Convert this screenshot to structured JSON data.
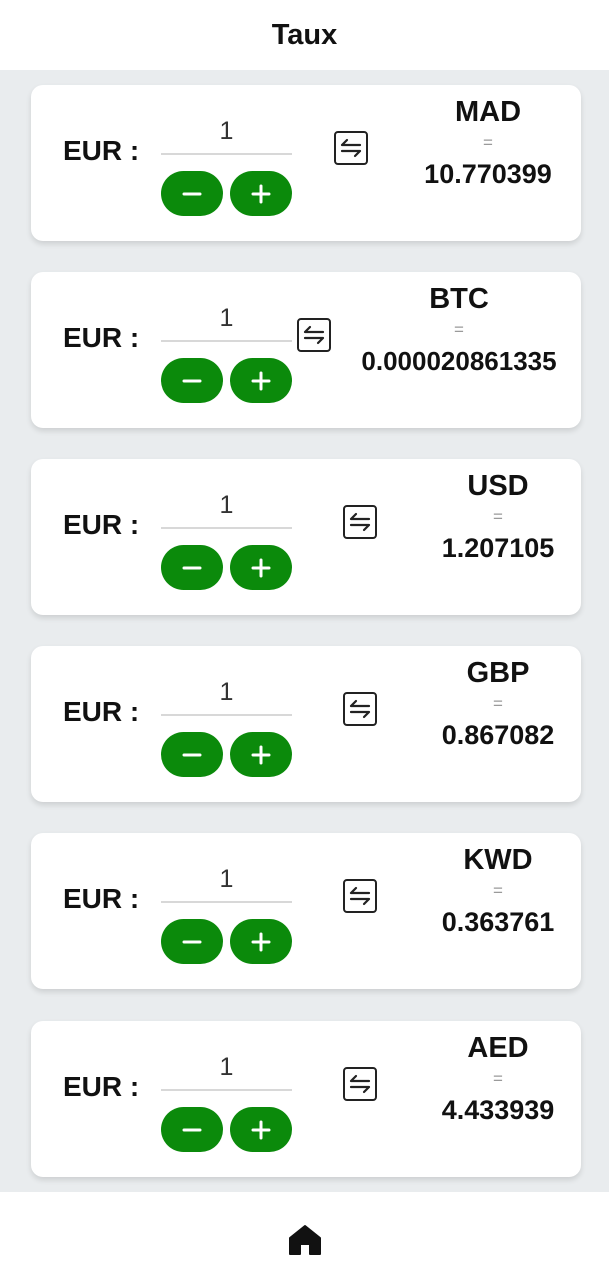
{
  "header": {
    "title": "Taux"
  },
  "base_currency_label": "EUR :",
  "equals_sign": "=",
  "icons": {
    "swap": "swap-arrows-icon",
    "minus": "minus-icon",
    "plus": "plus-icon",
    "home": "home-icon"
  },
  "colors": {
    "accent": "#0b8a0b",
    "background": "#e9ecee",
    "card": "#ffffff",
    "text": "#111111",
    "muted": "#9a9a9a"
  },
  "rates": [
    {
      "amount": "1",
      "code": "MAD",
      "value": "10.770399"
    },
    {
      "amount": "1",
      "code": "BTC",
      "value": "0.000020861335"
    },
    {
      "amount": "1",
      "code": "USD",
      "value": "1.207105"
    },
    {
      "amount": "1",
      "code": "GBP",
      "value": "0.867082"
    },
    {
      "amount": "1",
      "code": "KWD",
      "value": "0.363761"
    },
    {
      "amount": "1",
      "code": "AED",
      "value": "4.433939"
    }
  ],
  "bottom_nav": {
    "active": "home"
  }
}
